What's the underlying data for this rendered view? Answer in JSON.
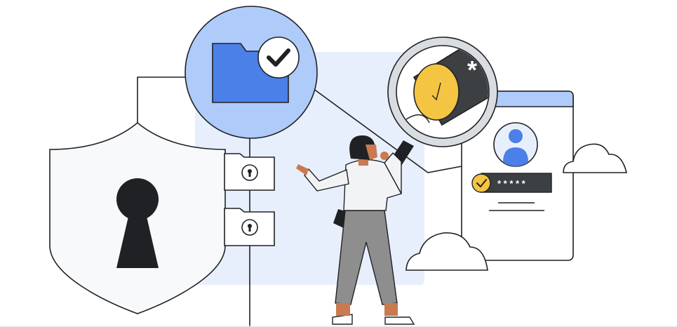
{
  "illustration": {
    "theme": "data-security",
    "login_card": {
      "password_mask": "* * * * *"
    },
    "lens_symbol": "*",
    "colors": {
      "ink": "#202124",
      "blue": "#4b80e8",
      "light_blue": "#aecbfa",
      "pale_blue": "#e8effc",
      "yellow": "#f4c542",
      "shield_fill": "#f8f9fa",
      "skin": "#c97a4f",
      "pants": "#8e8e8e"
    },
    "icons": [
      "shield-icon",
      "keyhole-icon",
      "folder-icon",
      "checkmark-icon",
      "padlock-icon",
      "magnifier-icon",
      "user-avatar-icon",
      "cloud-icon"
    ]
  }
}
